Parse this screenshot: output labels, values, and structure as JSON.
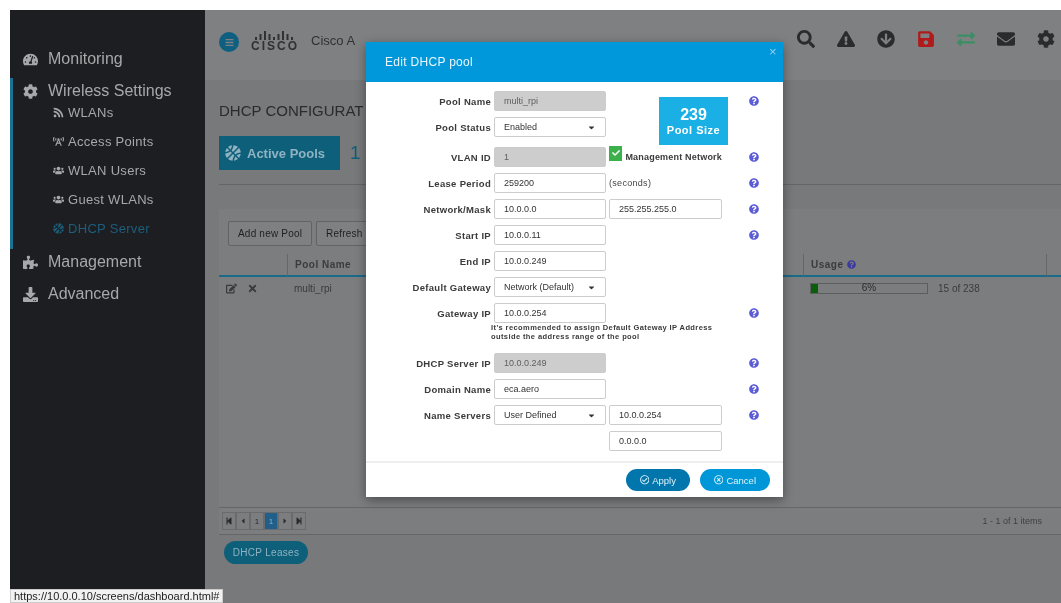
{
  "sidebar": {
    "items": [
      {
        "label": "Monitoring",
        "selected": false
      },
      {
        "label": "Wireless Settings",
        "selected": true,
        "children": [
          {
            "label": "WLANs",
            "selected": false
          },
          {
            "label": "Access Points",
            "selected": false
          },
          {
            "label": "WLAN Users",
            "selected": false
          },
          {
            "label": "Guest WLANs",
            "selected": false
          },
          {
            "label": "DHCP Server",
            "selected": true
          }
        ]
      },
      {
        "label": "Management",
        "selected": false
      },
      {
        "label": "Advanced",
        "selected": false
      }
    ]
  },
  "header": {
    "logo_text": "CISCO",
    "title": "Cisco A"
  },
  "page": {
    "title": "DHCP CONFIGURAT",
    "tile": {
      "label": "Active Pools",
      "count": "1"
    },
    "toolbar": [
      "Add new Pool",
      "Refresh"
    ],
    "table": {
      "columns": [
        "Pool Name",
        "Usage"
      ],
      "rows": [
        {
          "pool_name": "multi_rpi",
          "usage": {
            "level": 0.06,
            "percent": "6%",
            "count": "15 of 238"
          }
        }
      ]
    },
    "pager": {
      "page_input": "1",
      "pages": [
        {
          "label": "1",
          "selected": true
        }
      ],
      "info": "1 - 1 of 1 items"
    },
    "leases_button": "DHCP Leases"
  },
  "dialog": {
    "title": "Edit DHCP pool",
    "close": "×",
    "pool_size": {
      "value": "239",
      "label": "Pool Size"
    },
    "rows": [
      {
        "label": "Pool Name",
        "field": {
          "kind": "readonly",
          "value": "multi_rpi"
        },
        "help": true
      },
      {
        "label": "Pool Status",
        "field": {
          "kind": "select",
          "value": "Enabled"
        },
        "help": false
      },
      {
        "label": "VLAN ID",
        "field": {
          "kind": "readonly",
          "value": "1"
        },
        "side": {
          "kind": "checkbox",
          "label": "Management Network",
          "checked": true
        },
        "help": true
      },
      {
        "label": "Lease Period",
        "field": {
          "kind": "text",
          "value": "259200"
        },
        "side": {
          "kind": "unit",
          "label": "(seconds)"
        },
        "help": true
      },
      {
        "label": "Network/Mask",
        "field": {
          "kind": "text",
          "value": "10.0.0.0"
        },
        "side": {
          "kind": "text",
          "value": "255.255.255.0"
        },
        "help": true
      },
      {
        "label": "Start IP",
        "field": {
          "kind": "text",
          "value": "10.0.0.11"
        },
        "help": true
      },
      {
        "label": "End IP",
        "field": {
          "kind": "text",
          "value": "10.0.0.249"
        },
        "help": false
      },
      {
        "label": "Default Gateway",
        "field": {
          "kind": "select",
          "value": "Network (Default)"
        },
        "help": false
      },
      {
        "label": "Gateway IP",
        "field": {
          "kind": "text",
          "value": "10.0.0.254"
        },
        "help": true,
        "note": "It's recommended to assign Default Gateway IP Address outside the address range of the pool"
      },
      {
        "label": "DHCP Server IP",
        "field": {
          "kind": "readonly",
          "value": "10.0.0.249"
        },
        "help": true
      },
      {
        "label": "Domain Name",
        "field": {
          "kind": "text",
          "value": "eca.aero"
        },
        "help": true
      },
      {
        "label": "Name Servers",
        "field": {
          "kind": "select",
          "value": "User Defined"
        },
        "side": {
          "kind": "text",
          "value": "10.0.0.254"
        },
        "help": true
      },
      {
        "side": {
          "kind": "text",
          "value": "0.0.0.0"
        },
        "help": false
      }
    ],
    "buttons": [
      {
        "kind": "apply",
        "label": "Apply"
      },
      {
        "kind": "cancel",
        "label": "Cancel"
      }
    ]
  },
  "status_bar": "https://10.0.0.10/screens/dashboard.html#"
}
